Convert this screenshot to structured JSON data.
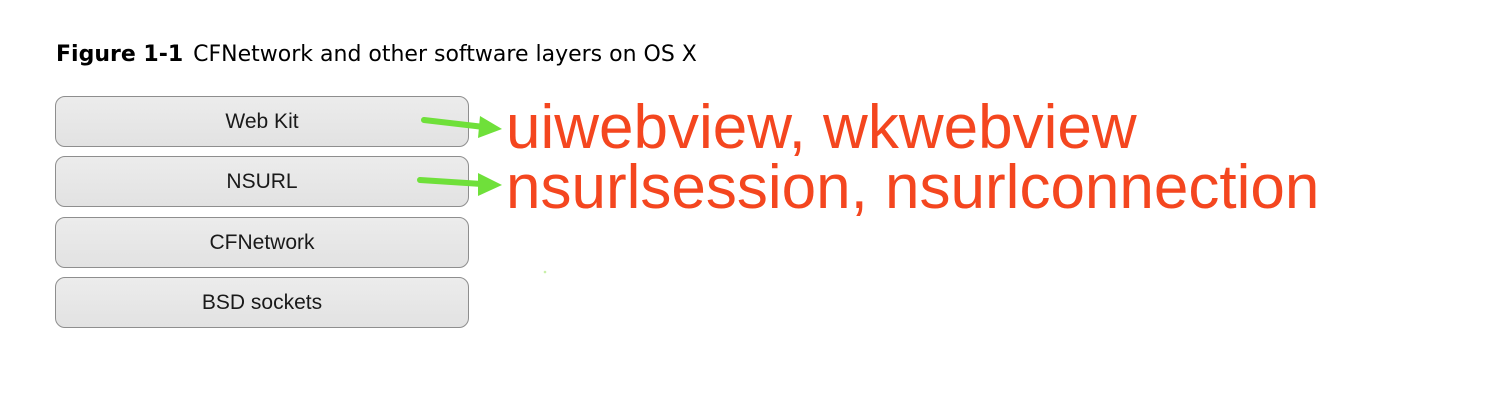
{
  "figure": {
    "number": "Figure 1-1",
    "title": "CFNetwork and other software layers on OS X"
  },
  "layers": [
    {
      "label": "Web Kit"
    },
    {
      "label": "NSURL"
    },
    {
      "label": "CFNetwork"
    },
    {
      "label": "BSD sockets"
    }
  ],
  "annotations": [
    {
      "text": "uiwebview, wkwebview",
      "points_to": "Web Kit"
    },
    {
      "text": "nsurlsession, nsurlconnection",
      "points_to": "NSURL"
    }
  ],
  "colors": {
    "annotation_text": "#f4461f",
    "arrow": "#6fe03a",
    "layer_fill": "#e6e6e6",
    "layer_border": "#8e8e8e"
  }
}
